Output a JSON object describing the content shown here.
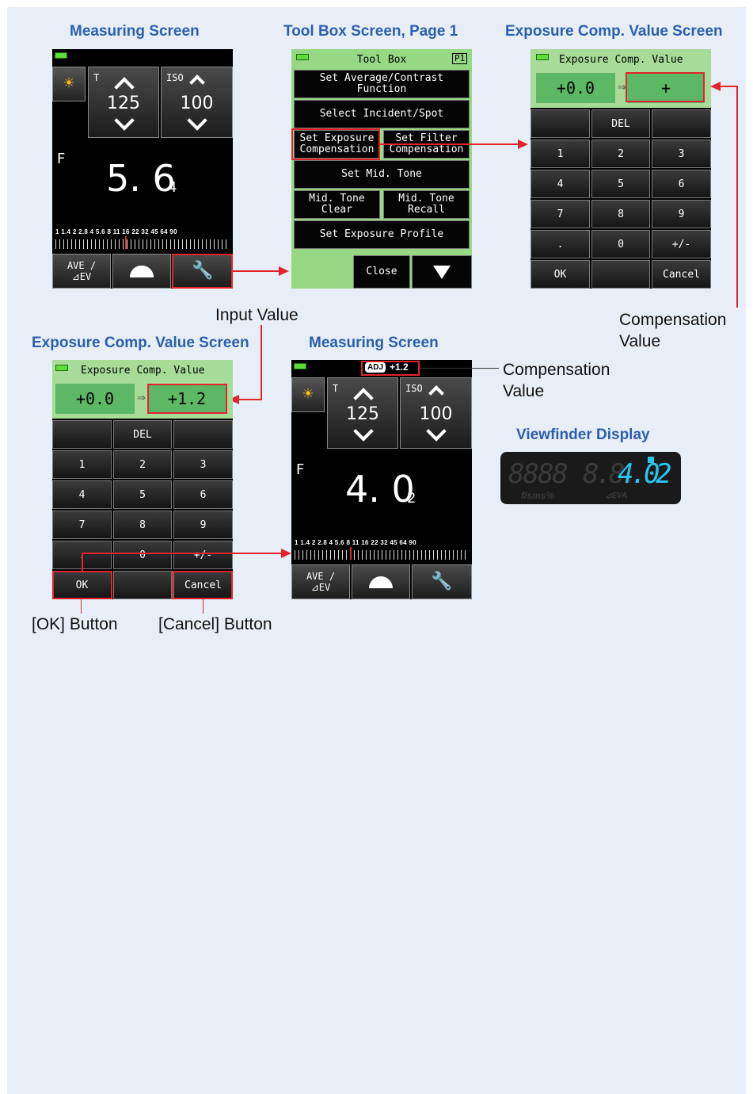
{
  "titles": {
    "measuring_1": "Measuring Screen",
    "toolbox": "Tool Box Screen, Page 1",
    "ecv_1": "Exposure Comp. Value Screen",
    "ecv_2": "Exposure Comp. Value Screen",
    "measuring_2": "Measuring Screen",
    "viewfinder": "Viewfinder Display"
  },
  "labels": {
    "input_value": "Input Value",
    "comp_value_1a": "Compensation",
    "comp_value_1b": "Value",
    "comp_value_2a": "Compensation",
    "comp_value_2b": "Value",
    "ok_button": "[OK] Button",
    "cancel_button": "[Cancel] Button"
  },
  "measuring_1": {
    "t_label": "T",
    "t_value": "125",
    "iso_label": "ISO",
    "iso_value": "100",
    "f_label": "F",
    "f_main": "5. 6",
    "f_sub": "4",
    "scale": "1 1.4 2 2.8 4 5.6 8 11 16 22 32 45 64 90",
    "btn_ave": "AVE /\n⊿EV"
  },
  "toolbox": {
    "header": "Tool Box",
    "page": "P1",
    "items": [
      "Set Average/Contrast\nFunction",
      "Select Incident/Spot",
      "Set Exposure\nCompensation",
      "Set Filter\nCompensation",
      "Set Mid. Tone",
      "Mid. Tone\nClear",
      "Mid. Tone\nRecall",
      "Set Exposure Profile"
    ],
    "close": "Close"
  },
  "ecv_1": {
    "header": "Exposure Comp. Value",
    "current": "+0.0",
    "arrow": "⇒",
    "input": "+",
    "keys": [
      "",
      "DEL",
      "",
      "1",
      "2",
      "3",
      "4",
      "5",
      "6",
      "7",
      "8",
      "9",
      ".",
      "0",
      "+/-",
      "OK",
      "",
      "Cancel"
    ]
  },
  "ecv_2": {
    "header": "Exposure Comp. Value",
    "current": "+0.0",
    "arrow": "⇒",
    "input": "+1.2",
    "keys": [
      "",
      "DEL",
      "",
      "1",
      "2",
      "3",
      "4",
      "5",
      "6",
      "7",
      "8",
      "9",
      ".",
      "0",
      "+/-",
      "OK",
      "",
      "Cancel"
    ]
  },
  "measuring_2": {
    "adj_badge": "ADJ",
    "adj_value": "+1.2",
    "t_label": "T",
    "t_value": "125",
    "iso_label": "ISO",
    "iso_value": "100",
    "f_label": "F",
    "f_main": "4. 0",
    "f_sub": "2",
    "scale": "1 1.4 2 2.8 4 5.6 8 11 16 22 32 45 64 90",
    "btn_ave": "AVE /\n⊿EV"
  },
  "viewfinder": {
    "ghost_digits": "8888",
    "ghost_digits_2": "8.8.",
    "lit_value": "4.0",
    "lit_sub": "2",
    "unit_left": "f/sms%",
    "unit_right": "⊿EVA"
  },
  "colors": {
    "title_blue": "#2b5fae",
    "callout_red": "#e3242b",
    "screen_green": "#a6dc97",
    "viewfinder_cyan": "#29c6f2"
  }
}
